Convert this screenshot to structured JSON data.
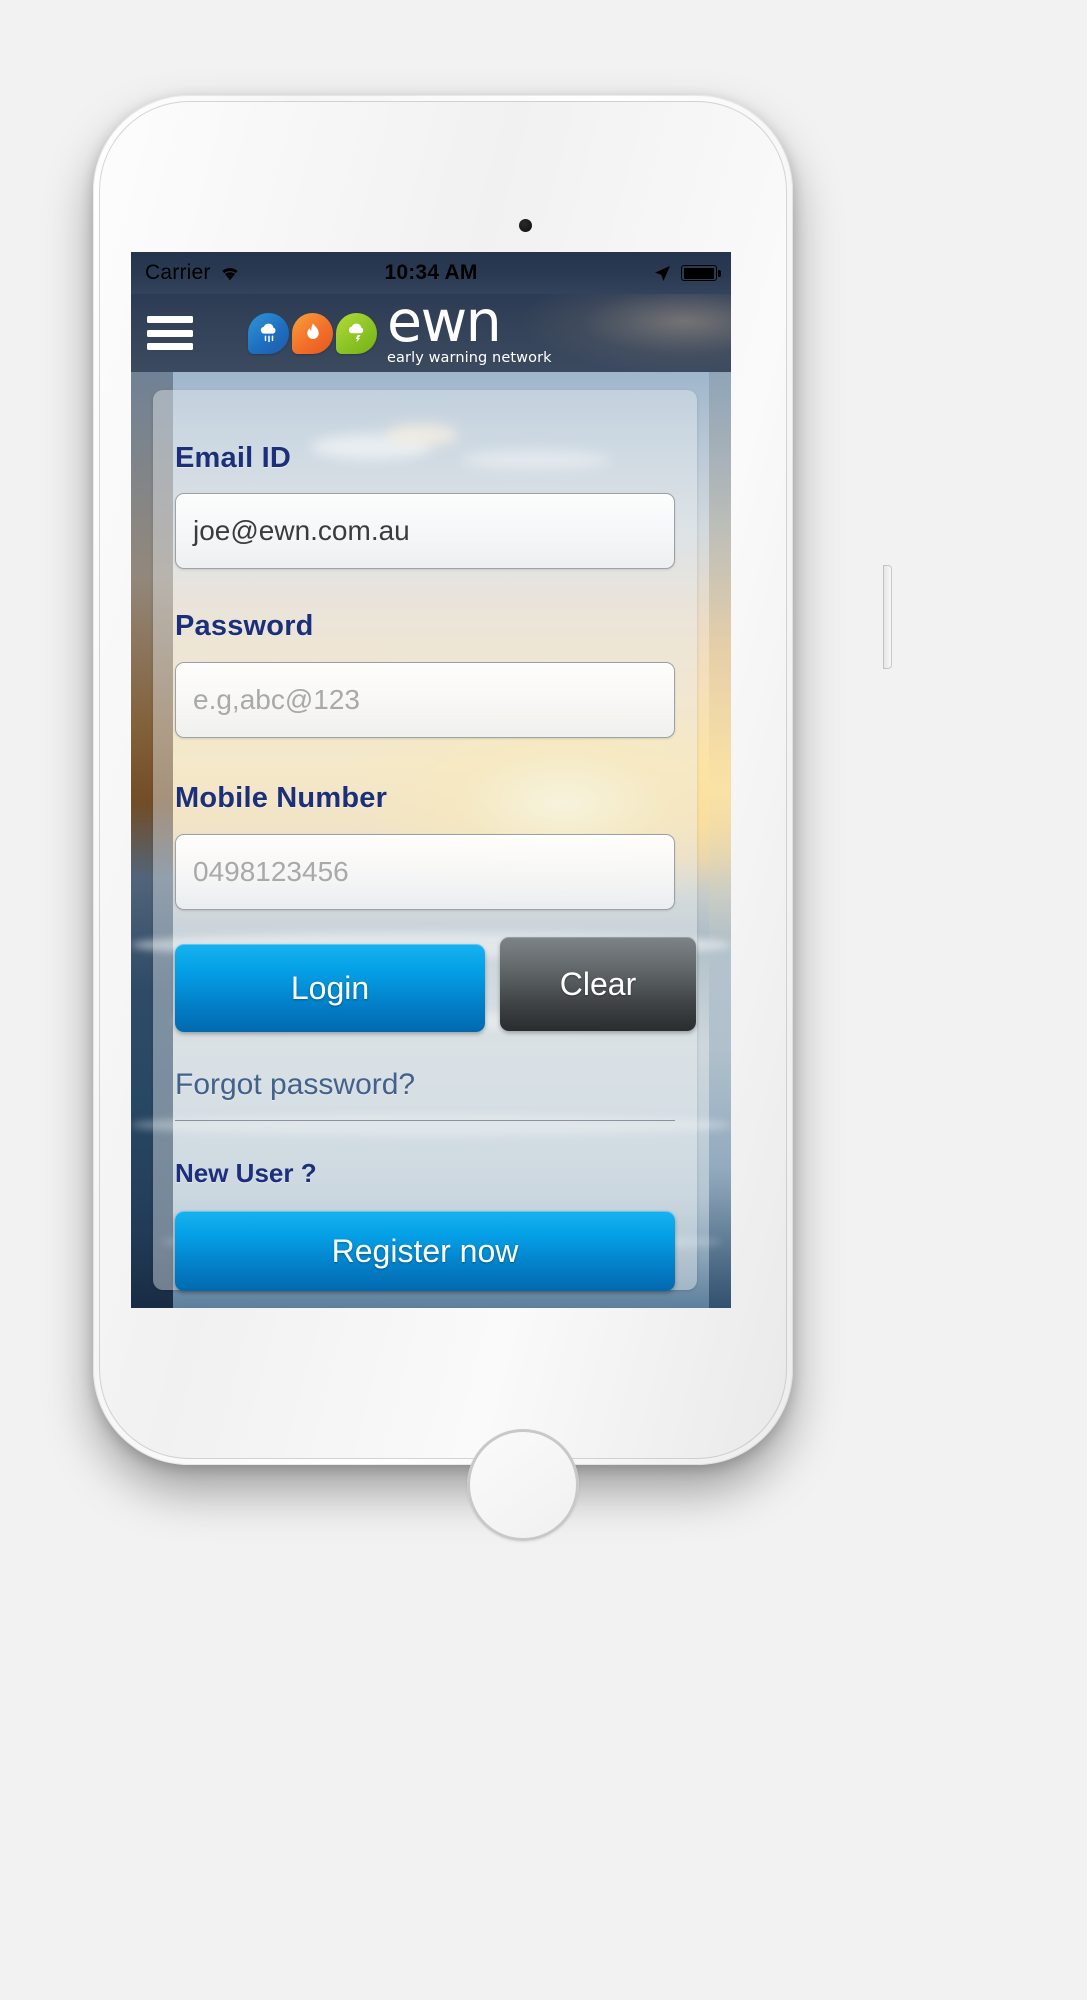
{
  "status_bar": {
    "carrier": "Carrier",
    "time": "10:34 AM",
    "wifi_icon": "wifi-icon",
    "location_icon": "location-arrow-icon",
    "battery_icon": "battery-full-icon"
  },
  "header": {
    "menu_icon": "hamburger-menu-icon",
    "logo": {
      "icons": [
        {
          "name": "rain-cloud-icon",
          "color": "#1f6fc0"
        },
        {
          "name": "flame-icon",
          "color": "#f2702a"
        },
        {
          "name": "storm-cloud-icon",
          "color": "#8cc425"
        }
      ],
      "wordmark": "ewn",
      "tagline": "early warning network"
    }
  },
  "form": {
    "email": {
      "label": "Email ID",
      "value": "joe@ewn.com.au",
      "placeholder": "joe@ewn.com.au"
    },
    "password": {
      "label": "Password",
      "value": "",
      "placeholder": "e.g,abc@123"
    },
    "mobile": {
      "label": "Mobile Number",
      "value": "",
      "placeholder": "0498123456"
    }
  },
  "actions": {
    "login_label": "Login",
    "clear_label": "Clear",
    "forgot_password_label": "Forgot password?",
    "new_user_label": "New User ?",
    "register_label": "Register now"
  },
  "colors": {
    "primary_blue": "#04a0e6",
    "label_navy": "#1b2f7a",
    "header_navy": "#334258",
    "link_slate": "#44618c",
    "clear_gray": "#64696c"
  }
}
